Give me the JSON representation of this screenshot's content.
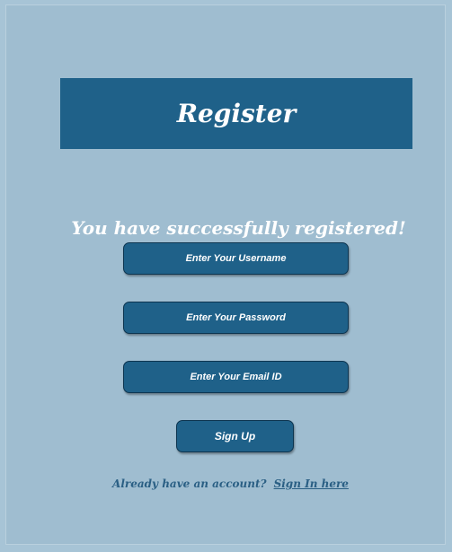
{
  "header": {
    "title": "Register"
  },
  "status": {
    "message": "You have successfully registered!"
  },
  "form": {
    "username_field": "Enter Your Username",
    "password_field": "Enter Your Password",
    "email_field": "Enter Your Email ID",
    "submit_label": "Sign Up"
  },
  "footer": {
    "prompt": "Already have an account?",
    "link_label": "Sign In here"
  },
  "colors": {
    "background": "#9fbdd0",
    "accent": "#1f6189",
    "text_light": "#ffffff",
    "link": "#2a5f84"
  }
}
